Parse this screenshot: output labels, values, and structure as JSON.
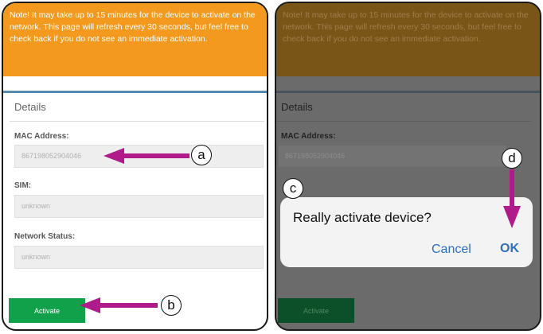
{
  "note": {
    "text": "Note! It may take up to 15 minutes for the device to activate on the network. This page will refresh every 30 seconds, but feel free to check back if you do not see an immediate activation."
  },
  "details": {
    "title": "Details",
    "mac_label": "MAC Address:",
    "mac_value": "867198052904046",
    "sim_label": "SIM:",
    "sim_value": "unknown",
    "network_label": "Network Status:",
    "network_value": "unknown"
  },
  "activate_button": "Activate",
  "dialog": {
    "title": "Really activate device?",
    "cancel": "Cancel",
    "ok": "OK"
  },
  "callouts": {
    "a": "a",
    "b": "b",
    "c": "c",
    "d": "d"
  },
  "colors": {
    "accent_arrow": "#b01a8a",
    "note_orange": "#f39a1e",
    "activate_green": "#11a14b",
    "link_blue": "#2e6fc0"
  }
}
